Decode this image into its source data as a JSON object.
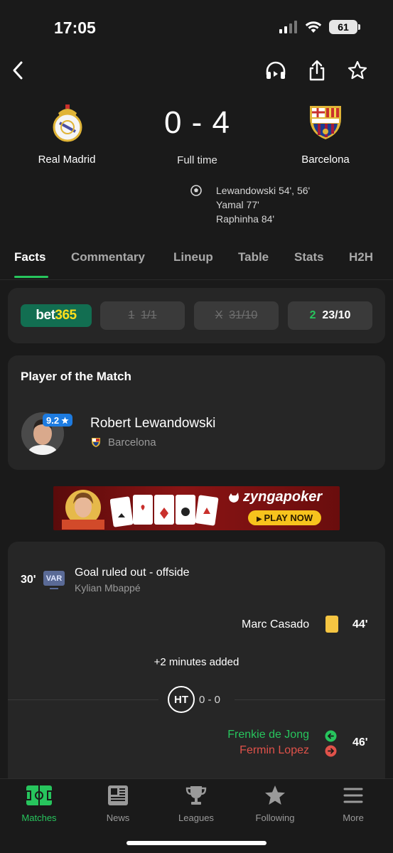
{
  "status": {
    "time": "17:05",
    "battery": "61"
  },
  "match": {
    "home_team": "Real Madrid",
    "away_team": "Barcelona",
    "score": "0 - 4",
    "status": "Full time",
    "scorers": [
      "Lewandowski 54', 56'",
      "Yamal 77'",
      "Raphinha 84'"
    ]
  },
  "tabs": [
    "Facts",
    "Commentary",
    "Lineup",
    "Table",
    "Stats",
    "H2H"
  ],
  "odds": {
    "provider": "bet365",
    "home": {
      "label": "1",
      "value": "1/1"
    },
    "draw": {
      "label": "X",
      "value": "31/10"
    },
    "away": {
      "label": "2",
      "value": "23/10"
    }
  },
  "potm": {
    "title": "Player of the Match",
    "rating": "9.2",
    "player": "Robert Lewandowski",
    "team": "Barcelona"
  },
  "ad": {
    "brand": "zyngapoker",
    "cta": "PLAY NOW"
  },
  "events": {
    "var": {
      "minute": "30'",
      "badge": "VAR",
      "title": "Goal ruled out - offside",
      "player": "Kylian Mbappé"
    },
    "card": {
      "minute": "44'",
      "player": "Marc Casado"
    },
    "added_time": "+2 minutes added",
    "halftime": {
      "label": "HT",
      "score": "0 - 0"
    },
    "sub": {
      "minute": "46'",
      "player_in": "Frenkie de Jong",
      "player_out": "Fermin Lopez"
    }
  },
  "nav": [
    {
      "label": "Matches",
      "icon": "pitch-icon",
      "active": true
    },
    {
      "label": "News",
      "icon": "news-icon"
    },
    {
      "label": "Leagues",
      "icon": "trophy-icon"
    },
    {
      "label": "Following",
      "icon": "star-icon"
    },
    {
      "label": "More",
      "icon": "menu-icon"
    }
  ],
  "colors": {
    "accent": "#27c55d",
    "sub_out": "#e0524a",
    "yellow_card": "#f5c542"
  }
}
